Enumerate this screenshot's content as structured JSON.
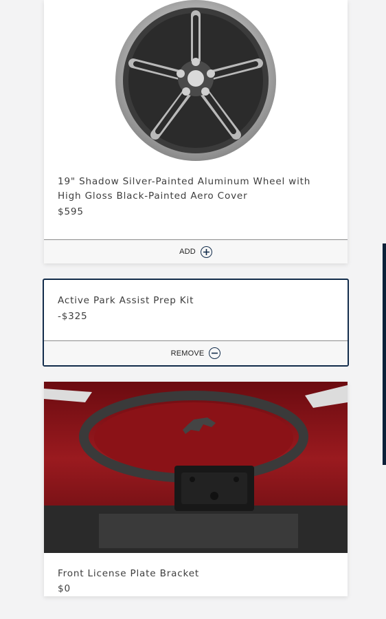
{
  "products": [
    {
      "title": "19\" Shadow Silver-Painted Aluminum Wheel with High Gloss Black-Painted Aero Cover",
      "price": "$595",
      "action_label": "ADD",
      "action_icon": "plus-circle-icon",
      "image_icon": "wheel-image"
    },
    {
      "title": "Active Park Assist Prep Kit",
      "price": "-$325",
      "action_label": "REMOVE",
      "action_icon": "minus-circle-icon",
      "selected": true
    },
    {
      "title": "Front License Plate Bracket",
      "price": "$0",
      "image_icon": "front-bumper-image"
    }
  ],
  "colors": {
    "accent": "#112b4a",
    "vehicle_red": "#8e1117",
    "background": "#f3f3f4"
  }
}
